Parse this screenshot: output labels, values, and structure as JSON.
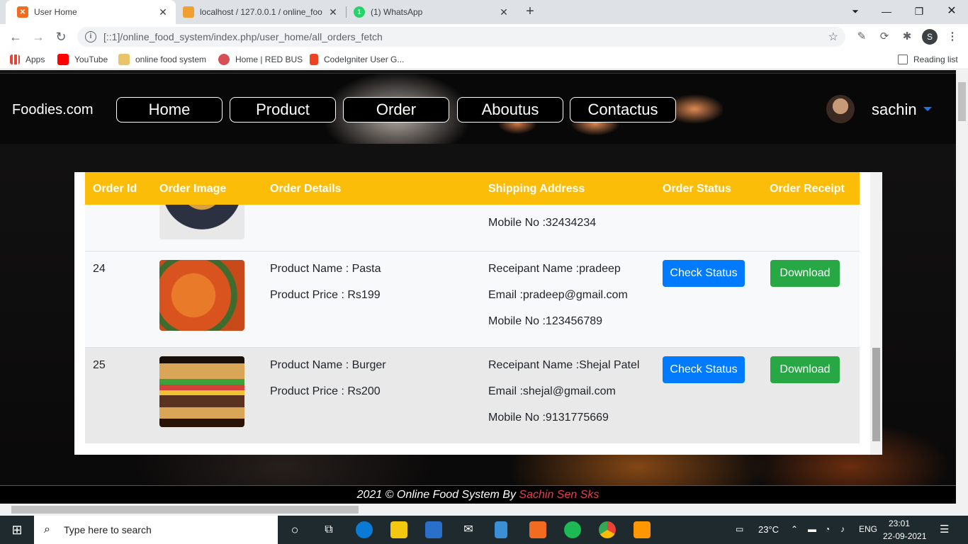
{
  "browser": {
    "tabs": [
      {
        "title": "User Home",
        "active": true
      },
      {
        "title": "localhost / 127.0.0.1 / online_foo",
        "active": false
      },
      {
        "title": "(1) WhatsApp",
        "active": false
      }
    ],
    "url": "[::1]/online_food_system/index.php/user_home/all_orders_fetch",
    "profile_initial": "S",
    "bookmarks": [
      "Apps",
      "YouTube",
      "online food system",
      "Home | RED BUS",
      "CodeIgniter User G..."
    ],
    "reading_list": "Reading list"
  },
  "site": {
    "brand": "Foodies.com",
    "nav": [
      "Home",
      "Product",
      "Order",
      "Aboutus",
      "Contactus"
    ],
    "username": "sachin"
  },
  "table": {
    "headers": [
      "Order Id",
      "Order Image",
      "Order Details",
      "Shipping Address",
      "Order Status",
      "Order Receipt"
    ],
    "partial_row": {
      "mobile": "Mobile No :32434234"
    },
    "rows": [
      {
        "id": "24",
        "product": "Product Name : Pasta",
        "price": "Product Price : Rs199",
        "recipient": "Receipant Name :pradeep",
        "email": "Email :pradeep@gmail.com",
        "mobile": "Mobile No :123456789",
        "status_btn": "Check Status",
        "receipt_btn": "Download",
        "image": "pasta"
      },
      {
        "id": "25",
        "product": "Product Name : Burger",
        "price": "Product Price : Rs200",
        "recipient": "Receipant Name :Shejal Patel",
        "email": "Email :shejal@gmail.com",
        "mobile": "Mobile No :9131775669",
        "status_btn": "Check Status",
        "receipt_btn": "Download",
        "image": "burger"
      }
    ]
  },
  "footer": {
    "text": "2021 © Online Food System By",
    "author": "Sachin Sen Sks"
  },
  "taskbar": {
    "search_placeholder": "Type here to search",
    "temperature": "23°C",
    "language": "ENG",
    "time": "23:01",
    "date": "22-09-2021"
  }
}
